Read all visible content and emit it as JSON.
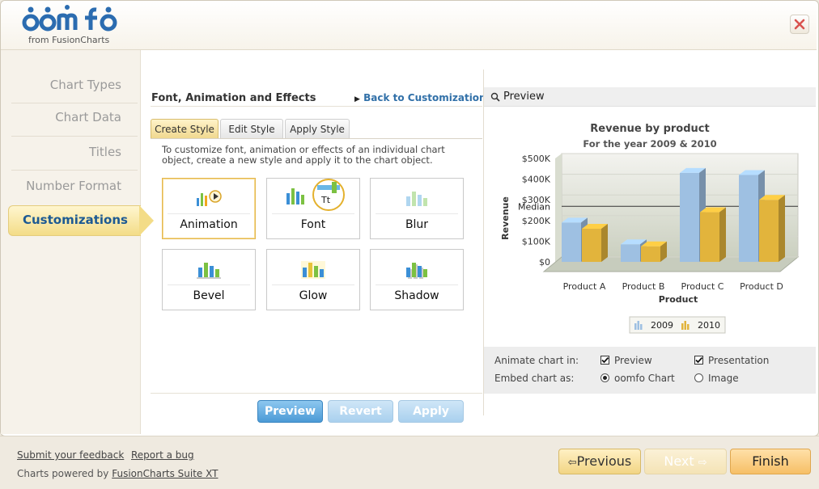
{
  "header": {
    "logo_text": "oomfo",
    "logo_sub": "from FusionCharts"
  },
  "sidebar": {
    "items": [
      {
        "label": "Chart Types"
      },
      {
        "label": "Chart Data"
      },
      {
        "label": "Titles"
      },
      {
        "label": "Number Format"
      },
      {
        "label": "Customizations",
        "active": true
      }
    ]
  },
  "section": {
    "title": "Font, Animation and Effects",
    "back_link": "Back to Customization"
  },
  "tabs": [
    {
      "label": "Create Style",
      "active": true
    },
    {
      "label": "Edit Style"
    },
    {
      "label": "Apply Style"
    }
  ],
  "description": "To customize font, animation or effects of an individual chart object, create a new style and apply it to the chart object.",
  "styles": [
    {
      "label": "Animation",
      "icon": "animation-chart-icon",
      "selected": true
    },
    {
      "label": "Font",
      "icon": "font-chart-icon",
      "badge": "Tt"
    },
    {
      "label": "Blur",
      "icon": "blur-chart-icon"
    },
    {
      "label": "Bevel",
      "icon": "bevel-chart-icon"
    },
    {
      "label": "Glow",
      "icon": "glow-chart-icon"
    },
    {
      "label": "Shadow",
      "icon": "shadow-chart-icon"
    }
  ],
  "actions": {
    "preview": "Preview",
    "revert": "Revert",
    "apply": "Apply"
  },
  "preview": {
    "header": "Preview",
    "animate_label": "Animate chart in:",
    "opt_preview": "Preview",
    "opt_presentation": "Presentation",
    "embed_label": "Embed chart as:",
    "opt_oomfo": "oomfo Chart",
    "opt_image": "Image"
  },
  "chart_data": {
    "type": "bar",
    "title": "Revenue by product",
    "subtitle": "For the year 2009 & 2010",
    "xlabel": "Product",
    "ylabel": "Revenue",
    "categories": [
      "Product A",
      "Product B",
      "Product C",
      "Product D"
    ],
    "series": [
      {
        "name": "2009",
        "values": [
          190,
          85,
          430,
          420
        ],
        "color": "#9ec0e2"
      },
      {
        "name": "2010",
        "values": [
          160,
          75,
          240,
          300
        ],
        "color": "#e2b43c"
      }
    ],
    "ylim": [
      0,
      500
    ],
    "yticks": [
      "$0",
      "$100K",
      "$200K",
      "$300K",
      "$400K",
      "$500K"
    ],
    "trendline": {
      "label": "Median",
      "value": 245
    },
    "legend": "bottom"
  },
  "footer": {
    "feedback": "Submit your feedback",
    "bug": "Report a bug",
    "powered_prefix": "Charts powered by",
    "powered_link": "FusionCharts Suite XT",
    "prev": "Previous",
    "next": "Next",
    "finish": "Finish"
  }
}
